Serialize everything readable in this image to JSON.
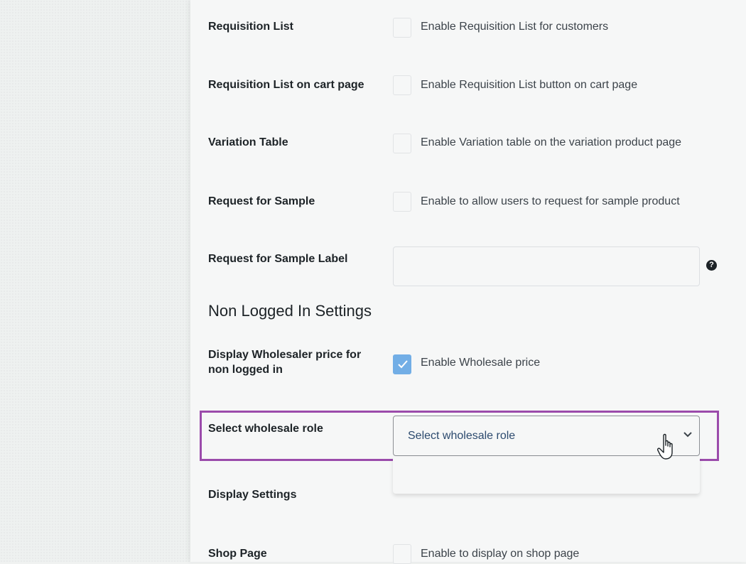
{
  "rows": [
    {
      "label": "Requisition List",
      "description": "Enable Requisition List for customers",
      "checked": false
    },
    {
      "label": "Requisition List on cart page",
      "description": "Enable Requisition List button on cart page",
      "checked": false
    },
    {
      "label": "Variation Table",
      "description": "Enable Variation table on the variation product page",
      "checked": false
    },
    {
      "label": "Request for Sample",
      "description": "Enable to allow users to request for sample product",
      "checked": false
    }
  ],
  "sample_label": {
    "label": "Request for Sample Label",
    "value": "",
    "help_icon": "question-circle-icon"
  },
  "non_logged_in": {
    "title": "Non Logged In Settings",
    "wholesaler_price": {
      "label_line1": "Display Wholesaler price for",
      "label_line2": "non logged in",
      "description": "Enable Wholesale price",
      "checked": true
    },
    "wholesale_role": {
      "label": "Select wholesale role",
      "selected": "Select wholesale role",
      "icon": "chevron-down-icon"
    }
  },
  "display_settings": {
    "label": "Display Settings"
  },
  "shop_page": {
    "label": "Shop Page",
    "description": "Enable to display on shop page",
    "checked": false
  },
  "colors": {
    "accent": "#72aee6",
    "highlight": "#9b4bab",
    "select_text": "#2c4a6e"
  },
  "cursor_icon": "hand-pointer-icon"
}
